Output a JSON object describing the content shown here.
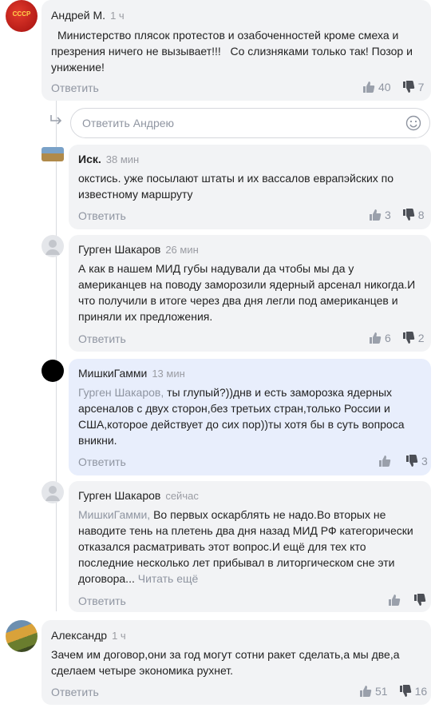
{
  "comments": [
    {
      "author": "Андрей М.",
      "time": "1 ч",
      "text_lines": [
        "Министерство плясок протестов и озабоченностей кроме смеха и",
        "презрения ничего не вызывает!!!   Со слизняками только так! Позор и",
        "унижение!"
      ],
      "reply_label": "Ответить",
      "likes": "40",
      "dislikes": "7",
      "avatar_text": "СССР"
    },
    {
      "author": "Иск.",
      "time": "38 мин",
      "text_lines": [
        "окстись. уже посылают штаты и их вассалов еврапэйских по",
        "известному маршруту"
      ],
      "reply_label": "Ответить",
      "likes": "3",
      "dislikes": "8"
    },
    {
      "author": "Гурген Шакаров",
      "time": "26 мин",
      "text_lines": [
        "А как в нашем МИД губы надували да чтобы мы да у",
        "американцев на поводу заморозили ядерный арсенал никогда.И",
        "что получили в итоге через два дня легли под американцев и",
        "приняли их предложения."
      ],
      "reply_label": "Ответить",
      "likes": "6",
      "dislikes": "2"
    },
    {
      "author": "МишкиГамми",
      "time": "13 мин",
      "mention": "Гурген Шакаров,",
      "text_lines": [
        " ты глупый?))днв и есть заморозка ядерных",
        "арсеналов с двух сторон,без третьих стран,только России и",
        "США,которое действует до сих пор))ты хотя бы в суть вопроса",
        "вникни."
      ],
      "reply_label": "Ответить",
      "likes": "",
      "dislikes": "3"
    },
    {
      "author": "Гурген Шакаров",
      "time": "сейчас",
      "mention": "МишкиГамми,",
      "text_lines": [
        " Во первых оскарблять не надо.Во вторых не",
        "наводите тень на плетень два дня назад МИД РФ категорически",
        "отказался расматривать этот вопрос.И ещё для тех кто",
        "последние несколько лет прибывал в литоргическом сне эти",
        "договора..."
      ],
      "read_more": " Читать ещё",
      "reply_label": "Ответить",
      "likes": "",
      "dislikes": ""
    },
    {
      "author": "Александр",
      "time": "1 ч",
      "text_lines": [
        "Зачем им договор,они за год могут сотни ракет сделать,а мы две,а",
        "сделаем четыре экономика рухнет."
      ],
      "reply_label": "Ответить",
      "likes": "51",
      "dislikes": "16"
    }
  ],
  "reply_box": {
    "placeholder": "Ответить Андрею"
  },
  "colors": {
    "bubble": "#f2f3f5",
    "highlight_bubble": "#e8eefc",
    "muted": "#8f95a1",
    "accent_red": "#c4161c"
  }
}
